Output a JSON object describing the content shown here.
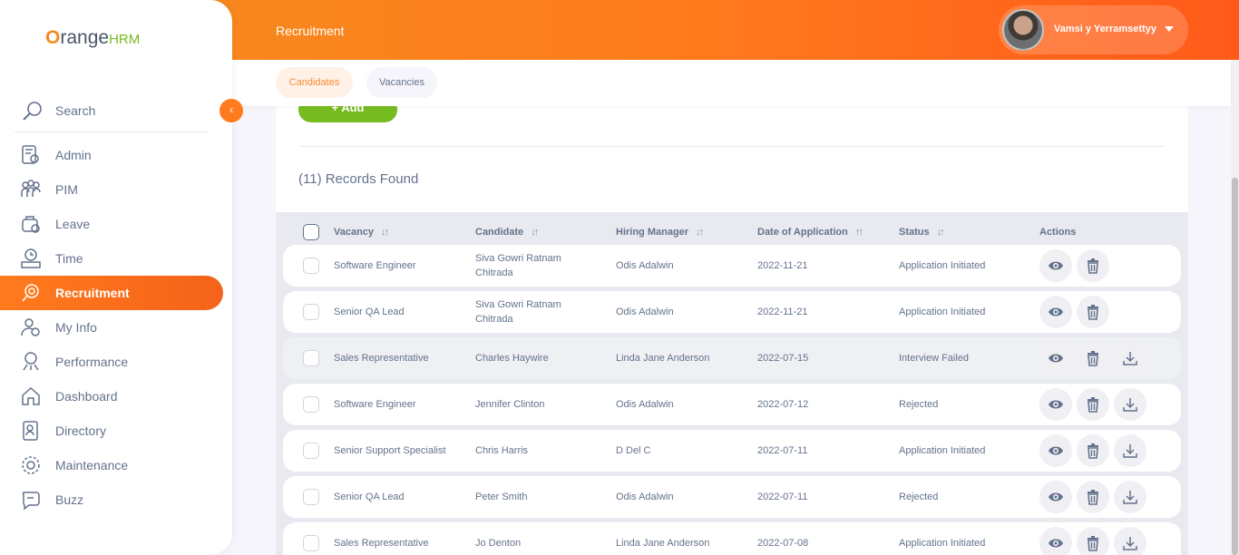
{
  "header": {
    "module_title": "Recruitment",
    "user_name": "Vamsi y Yerramsettyy"
  },
  "subnav": {
    "tabs": [
      {
        "label": "Candidates",
        "active": true
      },
      {
        "label": "Vacancies",
        "active": false
      }
    ]
  },
  "brand": {
    "logo_text_1": "range",
    "logo_text_2": "HRM",
    "colors": {
      "primary": "#ff7b1d",
      "green": "#76bc21"
    }
  },
  "sidebar": {
    "search_label": "Search",
    "items": [
      {
        "label": "Admin",
        "icon": "admin-icon"
      },
      {
        "label": "PIM",
        "icon": "pim-icon"
      },
      {
        "label": "Leave",
        "icon": "leave-icon"
      },
      {
        "label": "Time",
        "icon": "time-icon"
      },
      {
        "label": "Recruitment",
        "icon": "recruitment-icon",
        "active": true
      },
      {
        "label": "My Info",
        "icon": "my-info-icon"
      },
      {
        "label": "Performance",
        "icon": "performance-icon"
      },
      {
        "label": "Dashboard",
        "icon": "dashboard-icon"
      },
      {
        "label": "Directory",
        "icon": "directory-icon"
      },
      {
        "label": "Maintenance",
        "icon": "maintenance-icon"
      },
      {
        "label": "Buzz",
        "icon": "buzz-icon"
      }
    ]
  },
  "main": {
    "add_button_label": "+ Add",
    "records_found": "(11) Records Found",
    "columns": [
      "Vacancy",
      "Candidate",
      "Hiring Manager",
      "Date of Application",
      "Status",
      "Actions"
    ],
    "rows": [
      {
        "vacancy": "Software Engineer",
        "candidate_1": "Siva Gowri Ratnam",
        "candidate_2": "Chitrada",
        "manager": "Odis Adalwin",
        "date": "2022-11-21",
        "status": "Application Initiated",
        "download": false
      },
      {
        "vacancy": "Senior QA Lead",
        "candidate_1": "Siva Gowri Ratnam",
        "candidate_2": "Chitrada",
        "manager": "Odis Adalwin",
        "date": "2022-11-21",
        "status": "Application Initiated",
        "download": false
      },
      {
        "vacancy": "Sales Representative",
        "candidate_1": "Charles Haywire",
        "candidate_2": "",
        "manager": "Linda Jane Anderson",
        "date": "2022-07-15",
        "status": "Interview Failed",
        "download": true
      },
      {
        "vacancy": "Software Engineer",
        "candidate_1": "Jennifer Clinton",
        "candidate_2": "",
        "manager": "Odis Adalwin",
        "date": "2022-07-12",
        "status": "Rejected",
        "download": true
      },
      {
        "vacancy": "Senior Support Specialist",
        "candidate_1": "Chris Harris",
        "candidate_2": "",
        "manager": "D Del C",
        "date": "2022-07-11",
        "status": "Application Initiated",
        "download": true
      },
      {
        "vacancy": "Senior QA Lead",
        "candidate_1": "Peter Smith",
        "candidate_2": "",
        "manager": "Odis Adalwin",
        "date": "2022-07-11",
        "status": "Rejected",
        "download": true
      },
      {
        "vacancy": "Sales Representative",
        "candidate_1": "Jo Denton",
        "candidate_2": "",
        "manager": "Linda Jane Anderson",
        "date": "2022-07-08",
        "status": "Application Initiated",
        "download": true
      }
    ]
  }
}
